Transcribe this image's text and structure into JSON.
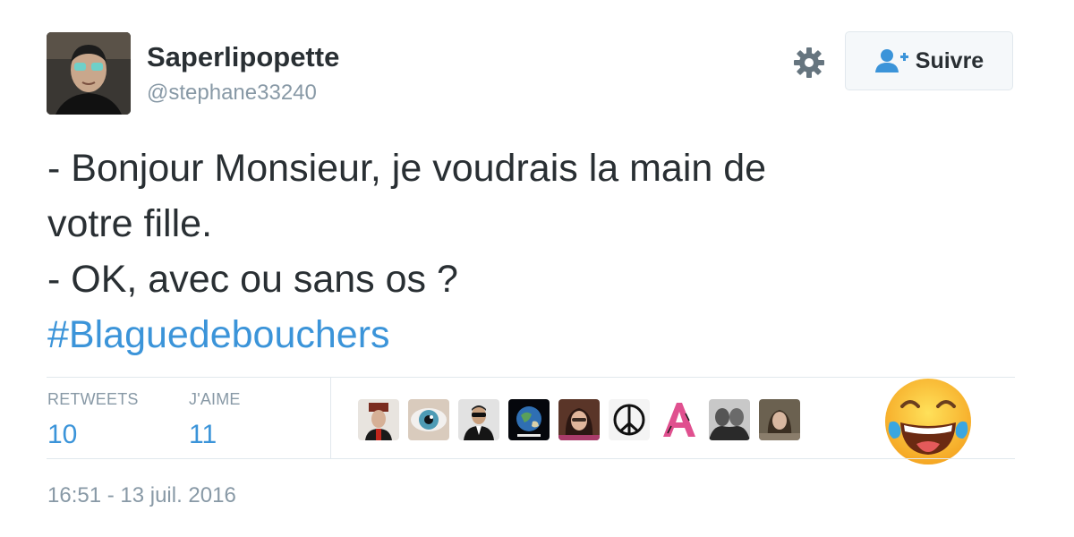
{
  "user": {
    "display_name": "Saperlipopette",
    "handle": "@stephane33240",
    "avatar_icon": "profile-photo"
  },
  "header": {
    "settings_icon": "gear-icon",
    "follow_label": "Suivre",
    "follow_icon": "add-user-icon"
  },
  "tweet": {
    "lines": [
      "- Bonjour Monsieur, je voudrais la main de",
      "votre fille.",
      "- OK, avec ou sans os ?"
    ],
    "hashtag": "#Blaguedebouchers",
    "accent_color": "#3b94d9"
  },
  "stats": {
    "retweets": {
      "label": "RETWEETS",
      "value": "10"
    },
    "likes": {
      "label": "J'AIME",
      "value": "11"
    }
  },
  "likers": [
    "liker-avatar-1",
    "liker-avatar-2",
    "liker-avatar-3",
    "liker-avatar-4",
    "liker-avatar-5",
    "liker-avatar-6",
    "liker-avatar-7",
    "liker-avatar-8",
    "liker-avatar-9"
  ],
  "reaction_emoji": "tears-of-joy-emoji",
  "timestamp": "16:51 - 13 juil. 2016"
}
